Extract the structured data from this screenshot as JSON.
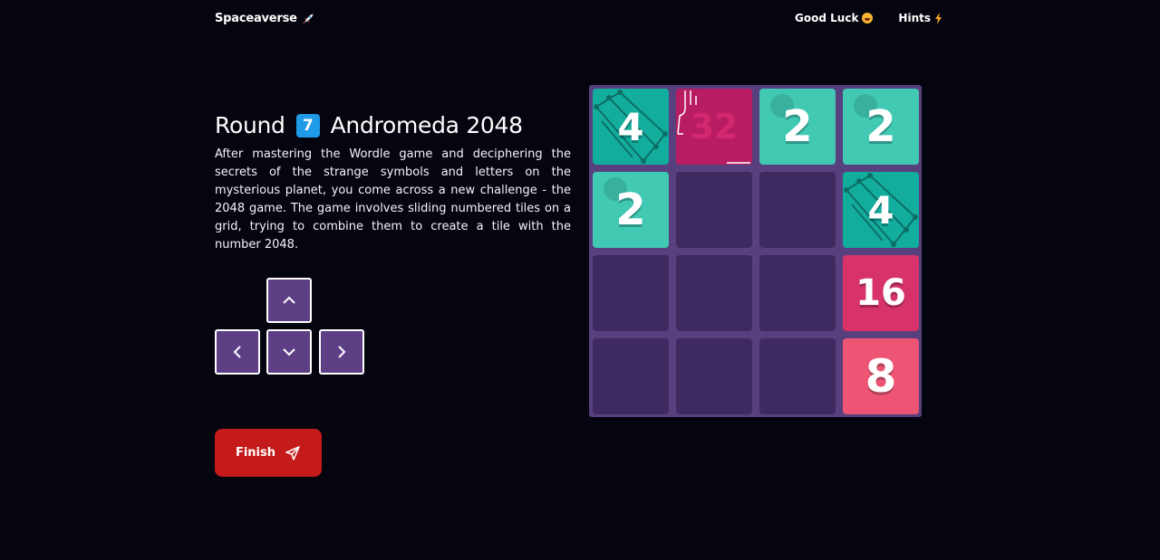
{
  "nav": {
    "brand": "Spaceaverse",
    "brand_icon": "rocket-icon",
    "links": [
      {
        "label": "Good Luck",
        "icon": "grinning-face-icon"
      },
      {
        "label": "Hints",
        "icon": "lightning-icon"
      }
    ]
  },
  "round": {
    "prefix": "Round",
    "number": "7",
    "name": "Andromeda 2048",
    "description": "After mastering the Wordle game and deciphering the secrets of the strange symbols and letters on the mysterious planet, you come across a new challenge - the 2048 game. The game involves sliding numbered tiles on a grid, trying to combine them to create a tile with the number 2048."
  },
  "controls": [
    "up",
    "left",
    "down",
    "right"
  ],
  "finish": {
    "label": "Finish",
    "icon": "send-icon"
  },
  "board": {
    "size": 4,
    "rows": [
      [
        4,
        32,
        2,
        2
      ],
      [
        2,
        0,
        0,
        4
      ],
      [
        0,
        0,
        0,
        16
      ],
      [
        0,
        0,
        0,
        8
      ]
    ]
  },
  "colors": {
    "background": "#05050f",
    "board": "#58407e",
    "empty_cell": "#3d2a60",
    "control": "#5e3f86",
    "finish": "#c41a1a",
    "badge": "#1f9be8",
    "tile_2": "#41c9b4",
    "tile_4": "#13ad9e",
    "tile_8": "#ee5575",
    "tile_16": "#d7336a",
    "tile_32": "#b81c63"
  }
}
